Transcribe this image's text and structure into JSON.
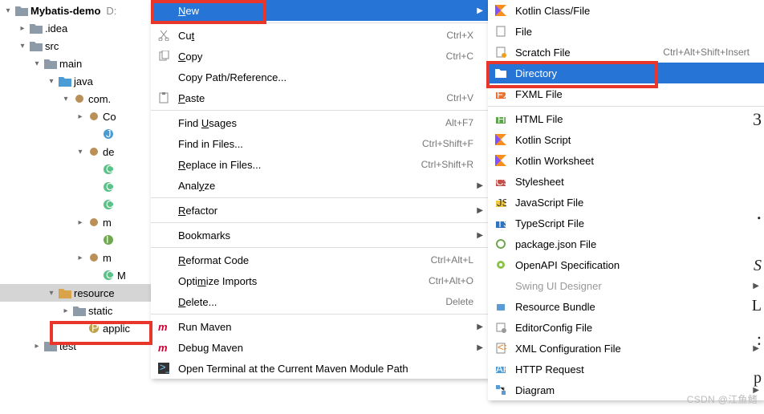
{
  "tree": {
    "root": {
      "label": "Mybatis-demo",
      "hint": "D:"
    },
    "items": [
      {
        "depth": 1,
        "arrow": "right",
        "label": ".idea"
      },
      {
        "depth": 1,
        "arrow": "down",
        "label": "src"
      },
      {
        "depth": 2,
        "arrow": "down",
        "label": "main"
      },
      {
        "depth": 3,
        "arrow": "down",
        "label": "java",
        "blue": true
      },
      {
        "depth": 4,
        "arrow": "down",
        "label": "com.",
        "pkg": true
      },
      {
        "depth": 5,
        "arrow": "right",
        "label": "Co",
        "pkg": true
      },
      {
        "depth": 6,
        "arrow": "",
        "label": "",
        "file": "j"
      },
      {
        "depth": 5,
        "arrow": "down",
        "label": "de",
        "pkg": true
      },
      {
        "depth": 6,
        "arrow": "",
        "label": "",
        "file": "c"
      },
      {
        "depth": 6,
        "arrow": "",
        "label": "",
        "file": "c"
      },
      {
        "depth": 6,
        "arrow": "",
        "label": "",
        "file": "c"
      },
      {
        "depth": 5,
        "arrow": "right",
        "label": "m",
        "pkg": true
      },
      {
        "depth": 6,
        "arrow": "",
        "label": "",
        "file": "i"
      },
      {
        "depth": 5,
        "arrow": "right",
        "label": "m",
        "pkg": true
      },
      {
        "depth": 6,
        "arrow": "",
        "label": "M",
        "file": "c"
      },
      {
        "depth": 3,
        "arrow": "down",
        "label": "resource",
        "res": true,
        "selected": true
      },
      {
        "depth": 4,
        "arrow": "right",
        "label": "static"
      },
      {
        "depth": 5,
        "arrow": "",
        "label": "applic",
        "file": "p"
      },
      {
        "depth": 2,
        "arrow": "right",
        "label": "test"
      }
    ]
  },
  "menu1": [
    {
      "type": "item",
      "label": "New",
      "ul": 0,
      "selected": true,
      "sub": true
    },
    {
      "type": "sep"
    },
    {
      "type": "item",
      "icon": "cut",
      "label": "Cut",
      "ul": 2,
      "short": "Ctrl+X"
    },
    {
      "type": "item",
      "icon": "copy",
      "label": "Copy",
      "ul": 0,
      "short": "Ctrl+C"
    },
    {
      "type": "item",
      "label": "Copy Path/Reference..."
    },
    {
      "type": "item",
      "icon": "paste",
      "label": "Paste",
      "ul": 0,
      "short": "Ctrl+V"
    },
    {
      "type": "sep"
    },
    {
      "type": "item",
      "label": "Find Usages",
      "ul": 5,
      "short": "Alt+F7"
    },
    {
      "type": "item",
      "label": "Find in Files...",
      "short": "Ctrl+Shift+F"
    },
    {
      "type": "item",
      "label": "Replace in Files...",
      "ul": 0,
      "short": "Ctrl+Shift+R"
    },
    {
      "type": "item",
      "label": "Analyze",
      "ul": 4,
      "sub": true
    },
    {
      "type": "sep"
    },
    {
      "type": "item",
      "label": "Refactor",
      "ul": 0,
      "sub": true
    },
    {
      "type": "sep"
    },
    {
      "type": "item",
      "label": "Bookmarks",
      "sub": true
    },
    {
      "type": "sep"
    },
    {
      "type": "item",
      "label": "Reformat Code",
      "ul": 0,
      "short": "Ctrl+Alt+L"
    },
    {
      "type": "item",
      "label": "Optimize Imports",
      "ul": 4,
      "short": "Ctrl+Alt+O"
    },
    {
      "type": "item",
      "label": "Delete...",
      "ul": 0,
      "short": "Delete"
    },
    {
      "type": "sep"
    },
    {
      "type": "item",
      "icon": "maven",
      "label": "Run Maven",
      "sub": true
    },
    {
      "type": "item",
      "icon": "maven",
      "label": "Debug Maven",
      "sub": true
    },
    {
      "type": "item",
      "icon": "term",
      "label": "Open Terminal at the Current Maven Module Path"
    }
  ],
  "menu2": [
    {
      "type": "item",
      "icon": "kotlin",
      "label": "Kotlin Class/File"
    },
    {
      "type": "item",
      "icon": "file",
      "label": "File"
    },
    {
      "type": "item",
      "icon": "scratch",
      "label": "Scratch File",
      "short": "Ctrl+Alt+Shift+Insert"
    },
    {
      "type": "item",
      "icon": "dir",
      "label": "Directory",
      "selected": true
    },
    {
      "type": "item",
      "icon": "fxml",
      "label": "FXML File"
    },
    {
      "type": "sep"
    },
    {
      "type": "item",
      "icon": "html",
      "label": "HTML File"
    },
    {
      "type": "item",
      "icon": "kotlin",
      "label": "Kotlin Script"
    },
    {
      "type": "item",
      "icon": "kotlin",
      "label": "Kotlin Worksheet"
    },
    {
      "type": "item",
      "icon": "css",
      "label": "Stylesheet"
    },
    {
      "type": "item",
      "icon": "js",
      "label": "JavaScript File"
    },
    {
      "type": "item",
      "icon": "ts",
      "label": "TypeScript File"
    },
    {
      "type": "item",
      "icon": "pkg",
      "label": "package.json File"
    },
    {
      "type": "item",
      "icon": "openapi",
      "label": "OpenAPI Specification"
    },
    {
      "type": "item",
      "label": "Swing UI Designer",
      "sub": true,
      "disabled": true
    },
    {
      "type": "item",
      "icon": "bundle",
      "label": "Resource Bundle"
    },
    {
      "type": "item",
      "icon": "editor",
      "label": "EditorConfig File"
    },
    {
      "type": "item",
      "icon": "xml",
      "label": "XML Configuration File",
      "sub": true
    },
    {
      "type": "item",
      "icon": "http",
      "label": "HTTP Request"
    },
    {
      "type": "item",
      "icon": "diagram",
      "label": "Diagram",
      "sub": true
    }
  ],
  "watermark": "CSDN @江鱼鳍",
  "rightChars": [
    "3",
    ".",
    "S",
    "L",
    ":",
    "p"
  ]
}
